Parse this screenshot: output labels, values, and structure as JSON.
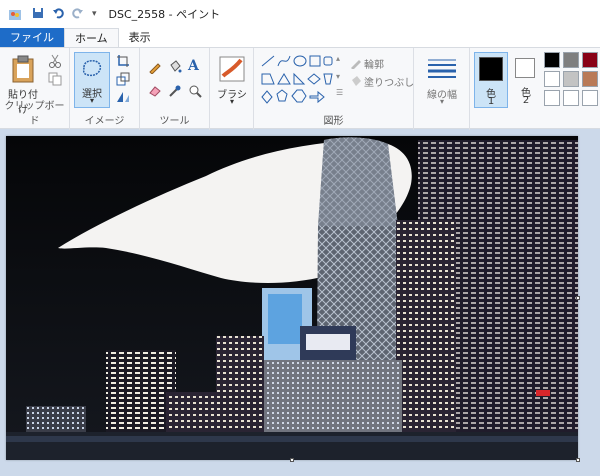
{
  "window": {
    "title": "DSC_2558 - ペイント"
  },
  "tabs": {
    "file": "ファイル",
    "home": "ホーム",
    "view": "表示"
  },
  "clipboard": {
    "paste": "貼り付け",
    "group": "クリップボード"
  },
  "image": {
    "select": "選択",
    "group": "イメージ"
  },
  "tools": {
    "group": "ツール"
  },
  "brush": {
    "label": "ブラシ"
  },
  "shapes": {
    "outline": "輪郭",
    "fill": "塗りつぶし",
    "group": "図形"
  },
  "size": {
    "label": "線の幅"
  },
  "colors": {
    "color1": "色",
    "color1_num": "1",
    "color2": "色",
    "color2_num": "2"
  },
  "palette": [
    "#000000",
    "#7f7f7f",
    "#880015",
    "#ffffff",
    "#c3c3c3",
    "#b97a57"
  ]
}
